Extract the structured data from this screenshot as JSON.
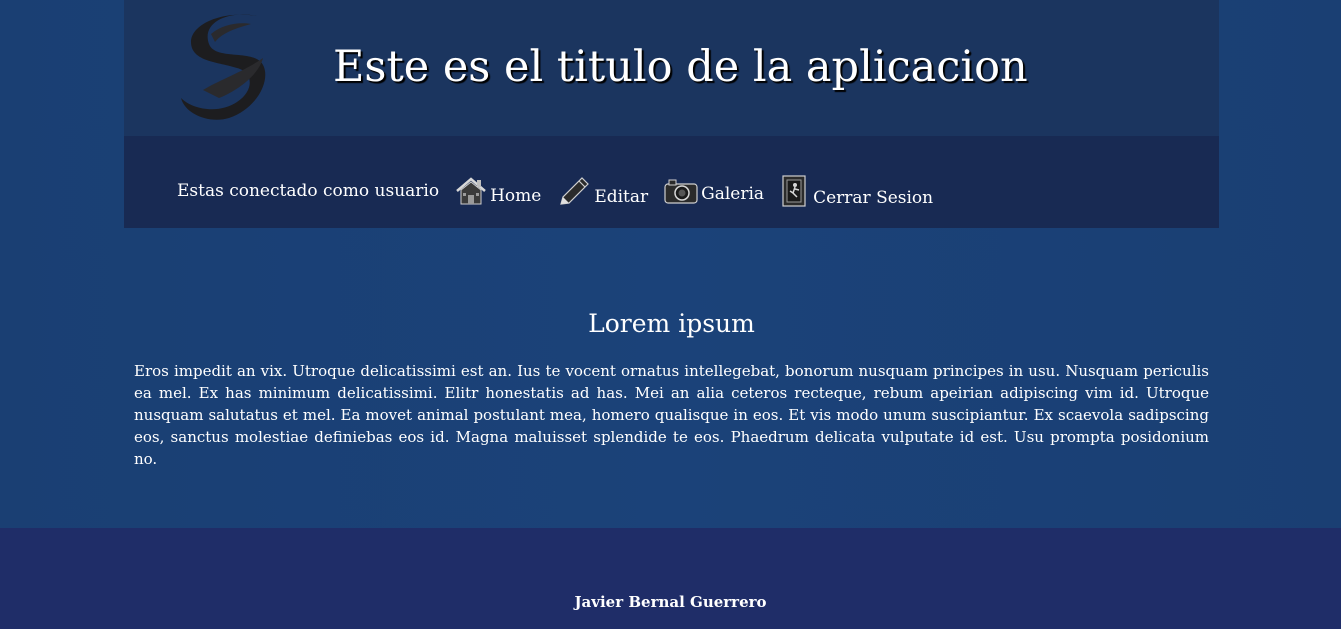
{
  "header": {
    "title": "Este es el titulo de la aplicacion",
    "logo_icon": "brush-swirl-logo"
  },
  "nav": {
    "user_status": "Estas conectado como usuario",
    "items": [
      {
        "label": "Home",
        "icon": "house-icon"
      },
      {
        "label": "Editar",
        "icon": "pencil-icon"
      },
      {
        "label": "Galeria",
        "icon": "camera-icon"
      },
      {
        "label": "Cerrar Sesion",
        "icon": "exit-door-icon"
      }
    ]
  },
  "main": {
    "heading": "Lorem ipsum",
    "paragraph": "Eros impedit an vix. Utroque delicatissimi est an. Ius te vocent ornatus intellegebat, bonorum nusquam principes in usu. Nusquam periculis ea mel. Ex has minimum delicatissimi. Elitr honestatis ad has. Mei an alia ceteros recteque, rebum apeirian adipiscing vim id. Utroque nusquam salutatus et mel. Ea movet animal postulant mea, homero qualisque in eos. Et vis modo unum suscipiantur. Ex scaevola sadipscing eos, sanctus molestiae definiebas eos id. Magna maluisset splendide te eos. Phaedrum delicata vulputate id est. Usu prompta posidonium no."
  },
  "footer": {
    "author": "Javier Bernal Guerrero"
  },
  "colors": {
    "background": "#1b4279",
    "header": "#1b355f",
    "navbar": "#182a53",
    "footer": "#1f2d68",
    "text": "#ffffff"
  }
}
